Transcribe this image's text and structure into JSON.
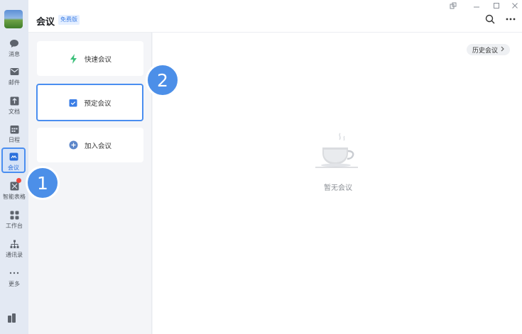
{
  "app": {
    "title": "会议",
    "edition_badge": "免费版"
  },
  "rail": {
    "items": [
      {
        "label": "消息",
        "icon": "chat-bubble-icon"
      },
      {
        "label": "邮件",
        "icon": "mail-icon"
      },
      {
        "label": "文档",
        "icon": "document-icon"
      },
      {
        "label": "日程",
        "icon": "calendar-icon"
      },
      {
        "label": "会议",
        "icon": "meeting-icon",
        "active": true
      },
      {
        "label": "智能表格",
        "icon": "smart-sheet-icon",
        "notification": true
      },
      {
        "label": "工作台",
        "icon": "workbench-icon"
      },
      {
        "label": "通讯录",
        "icon": "contacts-icon"
      },
      {
        "label": "更多",
        "icon": "more-dots-icon"
      }
    ]
  },
  "meeting_actions": [
    {
      "label": "快速会议",
      "icon": "lightning-icon"
    },
    {
      "label": "预定会议",
      "icon": "calendar-check-icon",
      "selected": true
    },
    {
      "label": "加入会议",
      "icon": "plus-circle-icon"
    }
  ],
  "main": {
    "history_button": "历史会议",
    "empty_text": "暂无会议"
  },
  "steps": [
    "1",
    "2"
  ],
  "colors": {
    "accent": "#4a8ef0",
    "step_marker": "#4c8fe8",
    "lightning": "#3cc07a",
    "notification": "#f0463c"
  }
}
